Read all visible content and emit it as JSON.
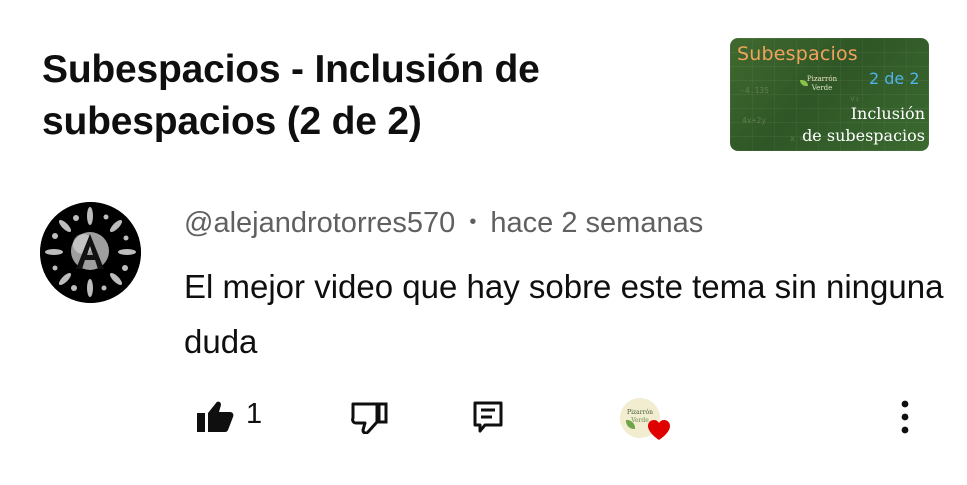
{
  "video": {
    "title": "Subespacios - Inclusión de subespacios (2 de 2)",
    "thumbnail": {
      "heading": "Subespacios",
      "part": "2 de 2",
      "topic_line1": "Inclusión",
      "topic_line2": "de subespacios",
      "logo_line1": "Pizarrón",
      "logo_line2": "Verde",
      "background_color": "#35602a",
      "heading_color": "#f1a35c",
      "part_color": "#4fb3e8"
    }
  },
  "comment": {
    "author": "@alejandrotorres570",
    "separator": "•",
    "timestamp": "hace 2 semanas",
    "text": "El mejor video que hay sobre este tema sin ninguna duda",
    "avatar_icon": "letter-a-splash-avatar",
    "likes": "1",
    "creator_heart": {
      "avatar_line1": "Pizarrón",
      "avatar_line2": "Verde",
      "heart_color": "#e00000"
    }
  },
  "icons": {
    "like": "thumbs-up-icon",
    "dislike": "thumbs-down-icon",
    "reply": "reply-comment-icon",
    "more": "vertical-dots-menu-icon"
  }
}
